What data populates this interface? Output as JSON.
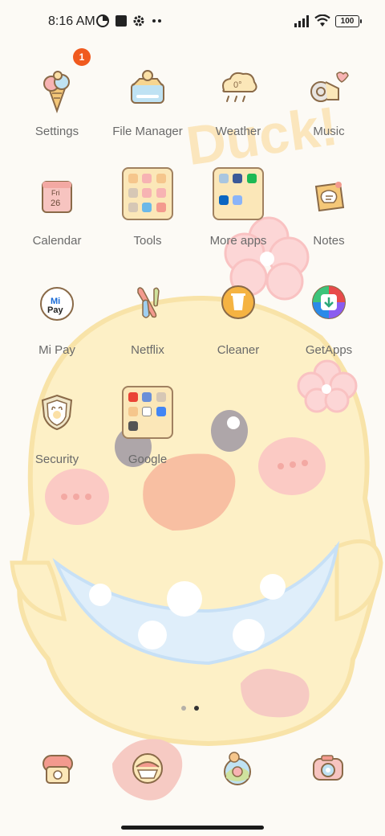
{
  "status_bar": {
    "time": "8:16 AM",
    "battery": "100",
    "icons": [
      "data-saver-icon",
      "square-icon",
      "gear-icon",
      "more-dots-icon",
      "signal-icon",
      "wifi-icon",
      "battery-icon"
    ]
  },
  "wallpaper_text": "Duck!",
  "badges": {
    "settings": "1"
  },
  "apps": [
    {
      "label": "Settings",
      "icon": "ice-cream-icon"
    },
    {
      "label": "File Manager",
      "icon": "folder-chick-icon"
    },
    {
      "label": "Weather",
      "icon": "cloud-icon",
      "temp": "0°"
    },
    {
      "label": "Music",
      "icon": "music-snail-icon"
    },
    {
      "label": "Calendar",
      "icon": "calendar-icon",
      "day": "Fri",
      "date": "26"
    },
    {
      "label": "Tools",
      "icon": "folder-icon"
    },
    {
      "label": "More apps",
      "icon": "folder-icon"
    },
    {
      "label": "Notes",
      "icon": "notes-icon"
    },
    {
      "label": "Mi Pay",
      "icon": "mi-pay-icon",
      "mi": "Mi",
      "pay": "Pay"
    },
    {
      "label": "Netflix",
      "icon": "netflix-icon"
    },
    {
      "label": "Cleaner",
      "icon": "cleaner-icon"
    },
    {
      "label": "GetApps",
      "icon": "getapps-icon"
    },
    {
      "label": "Security",
      "icon": "security-shield-icon"
    },
    {
      "label": "Google",
      "icon": "folder-icon"
    }
  ],
  "dock": [
    {
      "name": "phone-icon"
    },
    {
      "name": "messages-icon"
    },
    {
      "name": "browser-icon"
    },
    {
      "name": "camera-icon"
    }
  ],
  "page_indicator": {
    "pages": 2,
    "current": 2
  },
  "colors": {
    "accent": "#f05a1e",
    "folder_bg": "#fbe7b8",
    "duck": "#fdf0c6"
  }
}
